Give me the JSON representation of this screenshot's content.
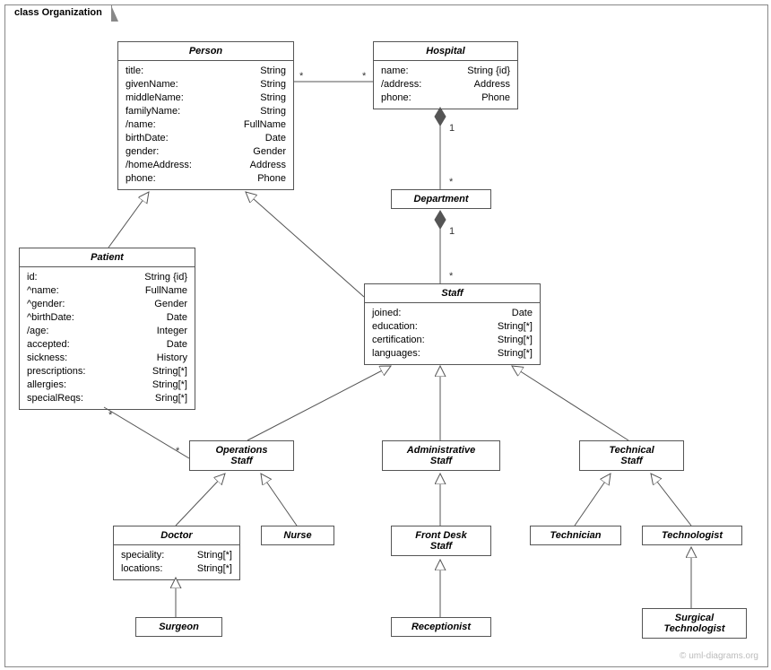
{
  "frame": {
    "label": "class Organization"
  },
  "classes": {
    "person": {
      "name": "Person",
      "attrs": [
        {
          "n": "title:",
          "t": "String"
        },
        {
          "n": "givenName:",
          "t": "String"
        },
        {
          "n": "middleName:",
          "t": "String"
        },
        {
          "n": "familyName:",
          "t": "String"
        },
        {
          "n": "/name:",
          "t": "FullName"
        },
        {
          "n": "birthDate:",
          "t": "Date"
        },
        {
          "n": "gender:",
          "t": "Gender"
        },
        {
          "n": "/homeAddress:",
          "t": "Address"
        },
        {
          "n": "phone:",
          "t": "Phone"
        }
      ]
    },
    "hospital": {
      "name": "Hospital",
      "attrs": [
        {
          "n": "name:",
          "t": "String {id}"
        },
        {
          "n": "/address:",
          "t": "Address"
        },
        {
          "n": "phone:",
          "t": "Phone"
        }
      ]
    },
    "department": {
      "name": "Department"
    },
    "patient": {
      "name": "Patient",
      "attrs": [
        {
          "n": "id:",
          "t": "String {id}"
        },
        {
          "n": "^name:",
          "t": "FullName"
        },
        {
          "n": "^gender:",
          "t": "Gender"
        },
        {
          "n": "^birthDate:",
          "t": "Date"
        },
        {
          "n": "/age:",
          "t": "Integer"
        },
        {
          "n": "accepted:",
          "t": "Date"
        },
        {
          "n": "sickness:",
          "t": "History"
        },
        {
          "n": "prescriptions:",
          "t": "String[*]"
        },
        {
          "n": "allergies:",
          "t": "String[*]"
        },
        {
          "n": "specialReqs:",
          "t": "Sring[*]"
        }
      ]
    },
    "staff": {
      "name": "Staff",
      "attrs": [
        {
          "n": "joined:",
          "t": "Date"
        },
        {
          "n": "education:",
          "t": "String[*]"
        },
        {
          "n": "certification:",
          "t": "String[*]"
        },
        {
          "n": "languages:",
          "t": "String[*]"
        }
      ]
    },
    "opsStaff": {
      "name": "Operations",
      "name2": "Staff"
    },
    "adminStaff": {
      "name": "Administrative",
      "name2": "Staff"
    },
    "techStaff": {
      "name": "Technical",
      "name2": "Staff"
    },
    "doctor": {
      "name": "Doctor",
      "attrs": [
        {
          "n": "speciality:",
          "t": "String[*]"
        },
        {
          "n": "locations:",
          "t": "String[*]"
        }
      ]
    },
    "nurse": {
      "name": "Nurse"
    },
    "frontDesk": {
      "name": "Front Desk",
      "name2": "Staff"
    },
    "technician": {
      "name": "Technician"
    },
    "technologist": {
      "name": "Technologist"
    },
    "surgeon": {
      "name": "Surgeon"
    },
    "receptionist": {
      "name": "Receptionist"
    },
    "surgTech": {
      "name": "Surgical",
      "name2": "Technologist"
    }
  },
  "mult": {
    "star": "*",
    "one": "1"
  },
  "watermark": "© uml-diagrams.org"
}
